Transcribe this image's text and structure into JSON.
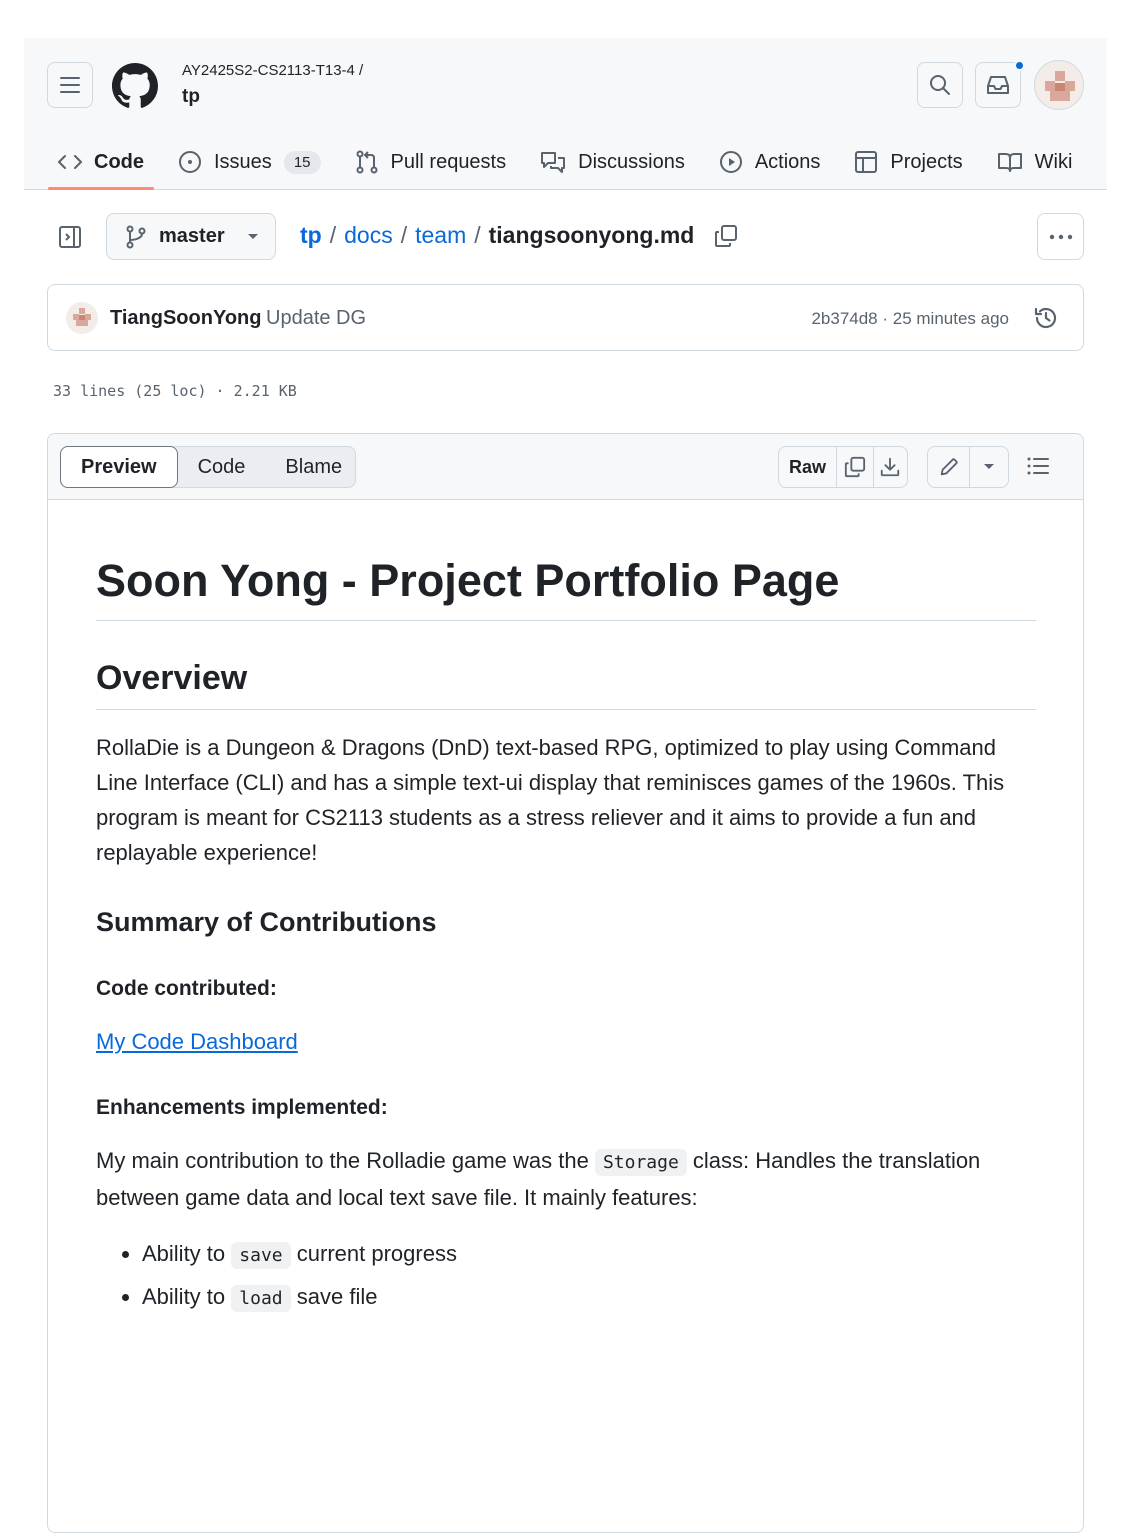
{
  "header": {
    "owner": "AY2425S2-CS2113-T13-4 /",
    "repo": "tp"
  },
  "tabs": [
    {
      "label": "Code",
      "icon": "code-icon",
      "active": true
    },
    {
      "label": "Issues",
      "icon": "issue-opened-icon",
      "count": "15"
    },
    {
      "label": "Pull requests",
      "icon": "git-pull-request-icon"
    },
    {
      "label": "Discussions",
      "icon": "comment-discussion-icon"
    },
    {
      "label": "Actions",
      "icon": "play-icon"
    },
    {
      "label": "Projects",
      "icon": "table-icon"
    },
    {
      "label": "Wiki",
      "icon": "book-icon"
    }
  ],
  "branch": {
    "name": "master"
  },
  "breadcrumb": {
    "parts": [
      "tp",
      "docs",
      "team"
    ],
    "separator": "/",
    "file": "tiangsoonyong.md"
  },
  "commit": {
    "author": "TiangSoonYong",
    "message": "Update DG",
    "meta": "2b374d8 · 25 minutes ago"
  },
  "file_meta": "33 lines (25 loc) · 2.21 KB",
  "view_tabs": [
    "Preview",
    "Code",
    "Blame"
  ],
  "toolbar": {
    "raw_label": "Raw"
  },
  "content": {
    "h1": "Soon Yong - Project Portfolio Page",
    "overview_heading": "Overview",
    "overview_text": "RollaDie is a Dungeon & Dragons (DnD) text-based RPG, optimized to play using Command Line Interface (CLI) and has a simple text-ui display that reminisces games of the 1960s. This program is meant for CS2113 students as a stress reliever and it aims to provide a fun and replayable experience!",
    "summary_heading": "Summary of Contributions",
    "code_contrib_heading": "Code contributed:",
    "dashboard_link": "My Code Dashboard",
    "enhancements_heading": "Enhancements implemented:",
    "enh_text_before": "My main contribution to the Rolladie game was the",
    "enh_code": "Storage",
    "enh_text_after": "class: Handles the translation between game data and local text save file. It mainly features:",
    "bullets": [
      {
        "before": "Ability to",
        "code": "save",
        "after": "current progress"
      },
      {
        "before": "Ability to",
        "code": "load",
        "after": "save file"
      }
    ]
  },
  "colors": {
    "accent": "#0969da",
    "active_tab_underline": "#fd8c73",
    "border": "#d1d9e0"
  }
}
